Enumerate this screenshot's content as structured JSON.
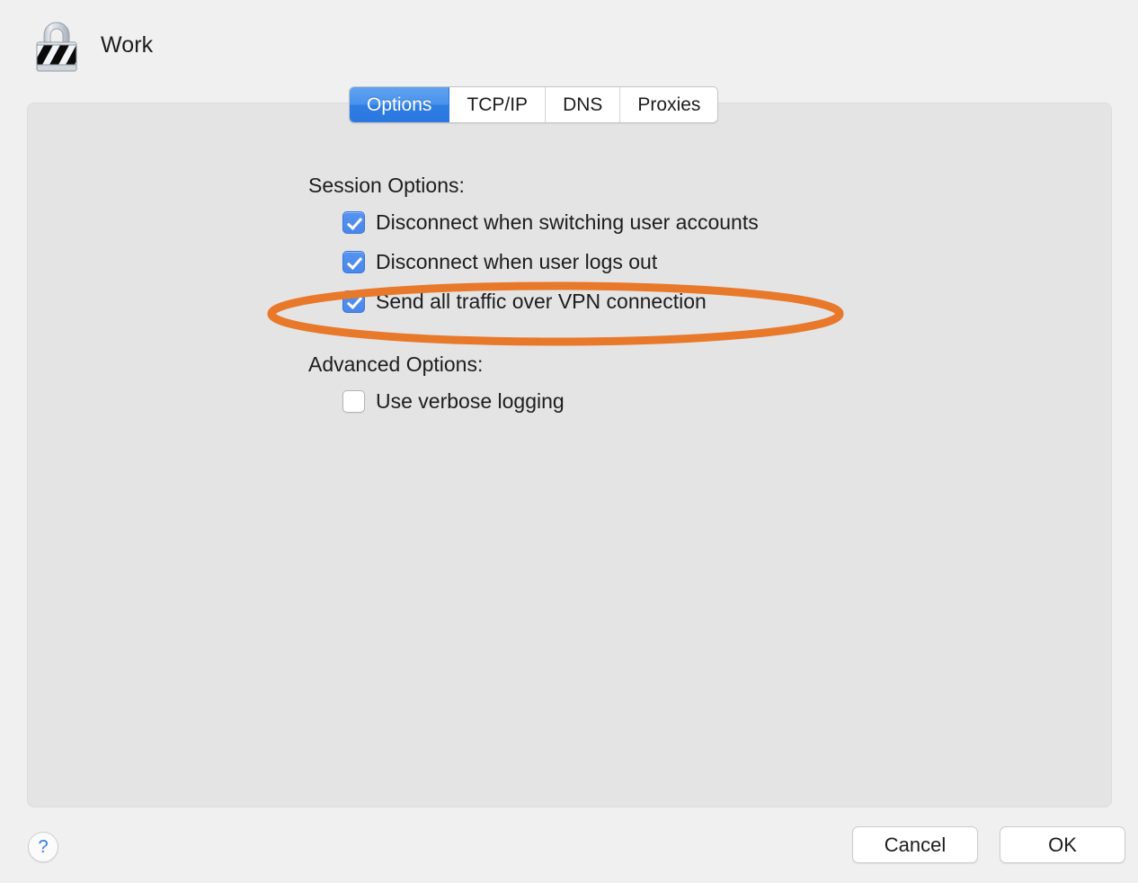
{
  "window": {
    "title": "Work",
    "icon": "lock-icon"
  },
  "tabs": [
    {
      "label": "Options",
      "selected": true
    },
    {
      "label": "TCP/IP",
      "selected": false
    },
    {
      "label": "DNS",
      "selected": false
    },
    {
      "label": "Proxies",
      "selected": false
    }
  ],
  "sections": {
    "session": {
      "label": "Session Options:",
      "options": [
        {
          "label": "Disconnect when switching user accounts",
          "checked": true
        },
        {
          "label": "Disconnect when user logs out",
          "checked": true
        },
        {
          "label": "Send all traffic over VPN connection",
          "checked": true
        }
      ]
    },
    "advanced": {
      "label": "Advanced Options:",
      "options": [
        {
          "label": "Use verbose logging",
          "checked": false
        }
      ]
    }
  },
  "annotation": {
    "shape": "ellipse",
    "color": "#e8782a",
    "targets": "Send all traffic over VPN connection"
  },
  "footer": {
    "help_label": "?",
    "cancel_label": "Cancel",
    "ok_label": "OK"
  },
  "colors": {
    "window_background": "#f0f0f0",
    "panel_background": "#e4e4e4",
    "accent_blue": "#4a8aec",
    "annotation_orange": "#e8782a",
    "help_blue": "#2f7ae5"
  }
}
